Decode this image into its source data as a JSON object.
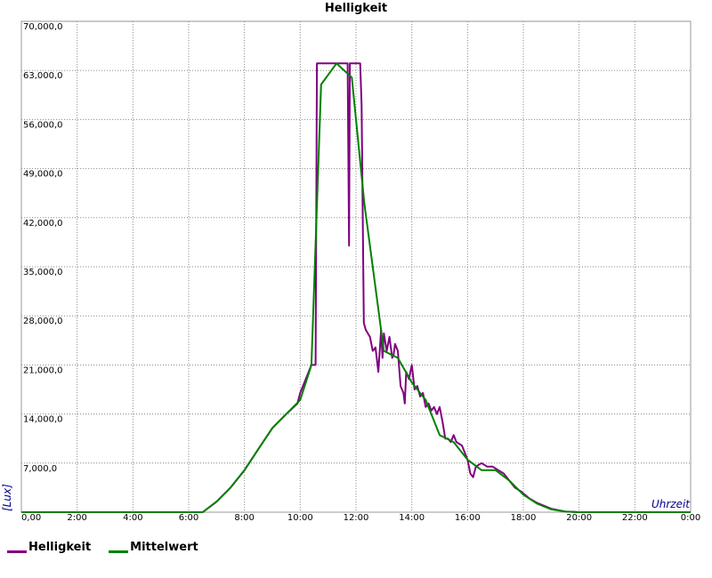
{
  "chart_data": {
    "type": "line",
    "title": "Helligkeit",
    "ylabel": "[Lux]",
    "xlabel": "Uhrzeit",
    "xlim": [
      0,
      24
    ],
    "ylim": [
      0,
      70000
    ],
    "grid": true,
    "legend_position": "bottom-left",
    "x_ticks": [
      "0,00",
      "2:00",
      "4:00",
      "6:00",
      "8:00",
      "10:00",
      "12:00",
      "14:00",
      "16:00",
      "18:00",
      "20:00",
      "22:00",
      "0:00"
    ],
    "y_ticks": [
      "7,000,0",
      "14,000,0",
      "21,000,0",
      "28,000,0",
      "35,000,0",
      "42,000,0",
      "49,000,0",
      "56,000,0",
      "63,000,0",
      "70,000,0"
    ],
    "series": [
      {
        "name": "Helligkeit",
        "color": "#800080",
        "x": [
          0,
          6.5,
          7,
          7.5,
          8,
          8.5,
          9,
          9.5,
          9.9,
          10,
          10.2,
          10.4,
          10.55,
          10.6,
          10.65,
          11.1,
          11.7,
          11.75,
          11.78,
          11.8,
          11.85,
          12.0,
          12.15,
          12.2,
          12.28,
          12.35,
          12.5,
          12.6,
          12.7,
          12.8,
          12.9,
          12.95,
          13.0,
          13.1,
          13.2,
          13.3,
          13.35,
          13.4,
          13.5,
          13.6,
          13.7,
          13.75,
          13.8,
          13.9,
          14.0,
          14.1,
          14.2,
          14.3,
          14.4,
          14.5,
          14.6,
          14.7,
          14.8,
          14.9,
          15.0,
          15.1,
          15.2,
          15.3,
          15.4,
          15.5,
          15.6,
          15.8,
          15.9,
          16.0,
          16.1,
          16.2,
          16.3,
          16.5,
          16.7,
          16.9,
          17.1,
          17.3,
          17.5,
          17.7,
          17.9,
          18.2,
          18.5,
          19.0,
          19.5,
          20.0,
          24
        ],
        "y": [
          0,
          0,
          1500,
          3500,
          6000,
          9000,
          12000,
          14000,
          15500,
          17000,
          19000,
          21000,
          21000,
          64000,
          64000,
          64000,
          64000,
          38000,
          64000,
          64000,
          64000,
          64000,
          64000,
          58000,
          27000,
          26000,
          25000,
          23000,
          23500,
          20000,
          26000,
          22000,
          25500,
          23000,
          25000,
          22000,
          22500,
          24000,
          23000,
          18000,
          17000,
          15500,
          20000,
          19000,
          21000,
          17500,
          18000,
          16500,
          17000,
          15000,
          15500,
          14500,
          15000,
          14000,
          15000,
          13000,
          10500,
          10500,
          10000,
          11000,
          10000,
          9500,
          8500,
          7500,
          5500,
          5000,
          6500,
          7000,
          6500,
          6500,
          6000,
          5500,
          4500,
          3500,
          3000,
          2000,
          1300,
          500,
          100,
          0,
          0
        ]
      },
      {
        "name": "Mittelwert",
        "color": "#008000",
        "x": [
          0,
          6.5,
          7,
          7.5,
          8,
          8.5,
          9,
          9.5,
          10,
          10.4,
          10.75,
          11.3,
          11.85,
          12.3,
          13.0,
          13.5,
          14.0,
          14.5,
          15.0,
          15.5,
          16.0,
          16.5,
          17.0,
          17.5,
          18.0,
          18.5,
          19.0,
          19.5,
          20.0,
          24
        ],
        "y": [
          0,
          0,
          1500,
          3500,
          6000,
          9000,
          12000,
          14000,
          16000,
          21000,
          61000,
          64000,
          62000,
          44000,
          23000,
          22000,
          18500,
          16000,
          11000,
          10000,
          7500,
          6000,
          6000,
          4500,
          2500,
          1200,
          400,
          100,
          0,
          0
        ]
      }
    ]
  }
}
